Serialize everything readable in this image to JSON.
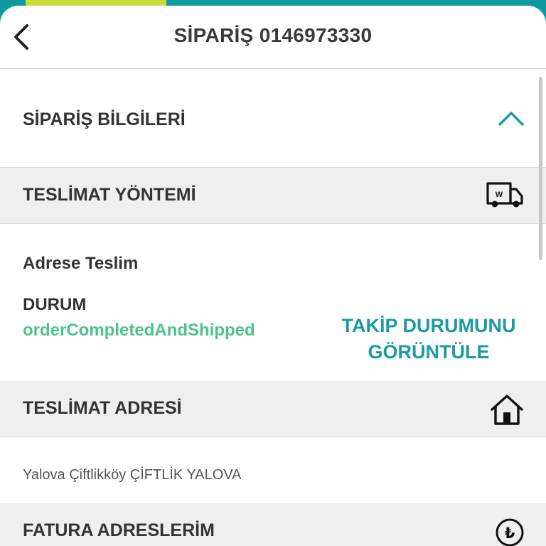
{
  "header": {
    "title": "SİPARİŞ 0146973330"
  },
  "order_info": {
    "title": "SİPARİŞ BİLGİLERİ"
  },
  "delivery_method": {
    "title": "TESLİMAT YÖNTEMİ",
    "icon": "delivery-truck-icon",
    "method": "Adrese Teslim",
    "status_label": "DURUM",
    "status_value": "orderCompletedAndShipped",
    "status_color": "#4cc38a",
    "track_line1": "TAKİP DURUMUNU",
    "track_line2": "GÖRÜNTÜLE",
    "truck_letter": "W"
  },
  "delivery_address": {
    "title": "TESLİMAT ADRESİ",
    "icon": "home-icon",
    "address": "Yalova Çiftlikköy ÇİFTLİK YALOVA"
  },
  "billing_address": {
    "title": "FATURA ADRESLERİM",
    "icon": "lira-coin-icon",
    "currency_symbol": "₺"
  },
  "colors": {
    "accent": "#1b9aa2",
    "brand_bar": "#0e9aa0",
    "chip": "#c8da3c"
  }
}
